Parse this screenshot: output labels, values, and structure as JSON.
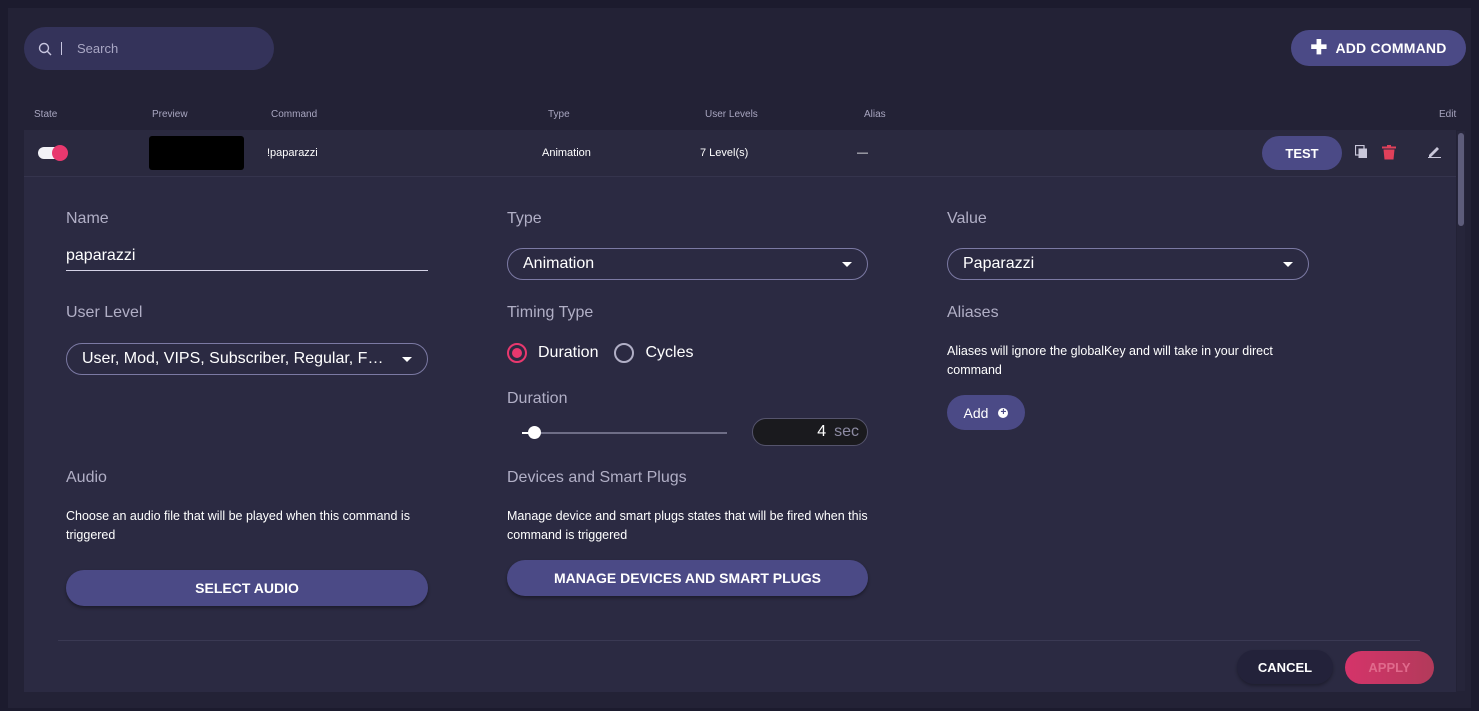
{
  "search": {
    "placeholder": "Search"
  },
  "toolbar": {
    "add_command_label": "ADD COMMAND"
  },
  "columns": {
    "state": "State",
    "preview": "Preview",
    "command": "Command",
    "type": "Type",
    "user_levels": "User Levels",
    "alias": "Alias",
    "edit": "Edit"
  },
  "row": {
    "enabled": true,
    "command": "!paparazzi",
    "type": "Animation",
    "user_levels": "7 Level(s)",
    "alias": "—",
    "test_label": "TEST"
  },
  "form": {
    "name_label": "Name",
    "name_value": "paparazzi",
    "type_label": "Type",
    "type_value": "Animation",
    "value_label": "Value",
    "value_value": "Paparazzi",
    "user_level_label": "User Level",
    "user_level_value": "User, Mod, VIPS, Subscriber, Regular, Foll...",
    "timing_type_label": "Timing Type",
    "timing_options": [
      "Duration",
      "Cycles"
    ],
    "timing_selected": "Duration",
    "aliases_label": "Aliases",
    "aliases_help": "Aliases will ignore the globalKey and will take in your direct command",
    "aliases_add_label": "Add",
    "duration_label": "Duration",
    "duration_value": "4",
    "duration_unit": "sec",
    "duration_slider_fraction": 0.06,
    "audio_label": "Audio",
    "audio_help": "Choose an audio file that will be played when this command is triggered",
    "select_audio_label": "SELECT AUDIO",
    "devices_label": "Devices and Smart Plugs",
    "devices_help": "Manage device and smart plugs states that will be fired when this command is triggered",
    "manage_devices_label": "MANAGE DEVICES AND SMART PLUGS",
    "cancel_label": "CANCEL",
    "apply_label": "APPLY"
  },
  "colors": {
    "accent": "#e8386e",
    "button": "#4b4a86",
    "background": "#232236"
  }
}
